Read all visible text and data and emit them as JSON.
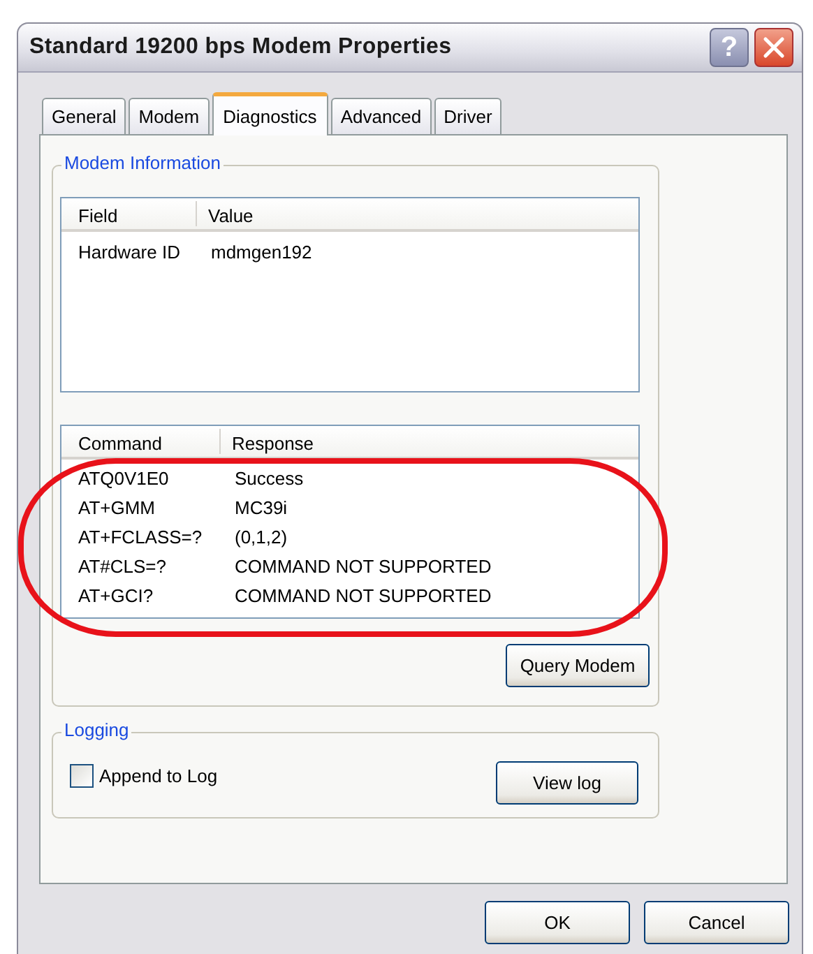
{
  "window": {
    "title": "Standard 19200 bps Modem Properties",
    "title_buttons": [
      {
        "kind": "help",
        "label": "?"
      },
      {
        "kind": "close"
      }
    ]
  },
  "tabs": [
    {
      "label": "General",
      "selected": false
    },
    {
      "label": "Modem",
      "selected": false
    },
    {
      "label": "Diagnostics",
      "selected": true
    },
    {
      "label": "Advanced",
      "selected": false
    },
    {
      "label": "Driver",
      "selected": false
    }
  ],
  "modem_information": {
    "title": "Modem Information",
    "info_list": {
      "columns": [
        "Field",
        "Value"
      ],
      "rows": [
        [
          "Hardware ID",
          "mdmgen192"
        ]
      ]
    },
    "command_list": {
      "columns": [
        "Command",
        "Response"
      ],
      "rows": [
        [
          "ATQ0V1E0",
          "Success"
        ],
        [
          "AT+GMM",
          "MC39i"
        ],
        [
          "AT+FCLASS=?",
          "(0,1,2)"
        ],
        [
          "AT#CLS=?",
          "COMMAND NOT SUPPORTED"
        ],
        [
          "AT+GCI?",
          "COMMAND NOT SUPPORTED"
        ]
      ]
    },
    "button": "Query Modem"
  },
  "logging": {
    "title": "Logging",
    "checkbox": {
      "label": "Append to Log",
      "checked": false
    },
    "button": "View log"
  },
  "annotation": {
    "kind": "ellipse"
  },
  "buttons": [
    "OK",
    "Cancel"
  ]
}
